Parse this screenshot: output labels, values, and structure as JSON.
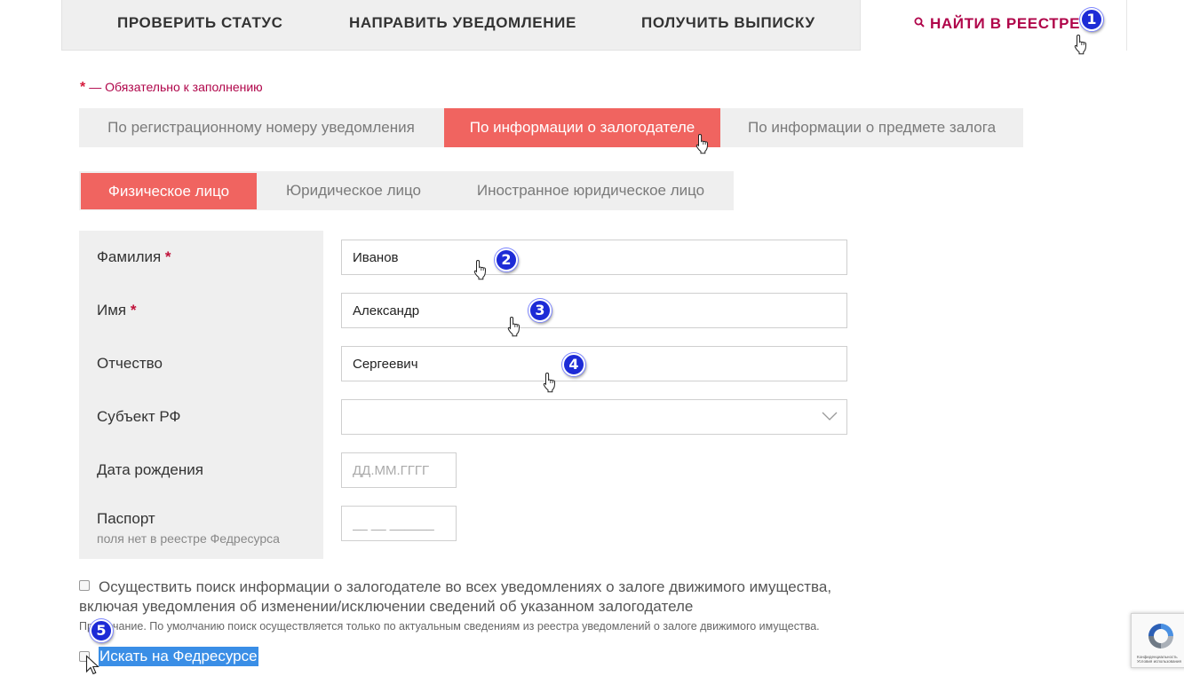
{
  "nav": {
    "items": [
      "ПРОВЕРИТЬ СТАТУС",
      "НАПРАВИТЬ УВЕДОМЛЕНИЕ",
      "ПОЛУЧИТЬ ВЫПИСКУ"
    ],
    "find_label": "НАЙТИ В РЕЕСТРЕ",
    "find_icon": "search-icon",
    "accent_color": "#b0054a"
  },
  "required_note": {
    "star": "*",
    "text": "— Обязательно к заполнению"
  },
  "mode_tabs": {
    "items": [
      "По регистрационному номеру уведомления",
      "По информации о залогодателе",
      "По информации о предмете залога"
    ],
    "active_index": 1,
    "active_color": "#f06460"
  },
  "person_tabs": {
    "items": [
      "Физическое лицо",
      "Юридическое лицо",
      "Иностранное юридическое лицо"
    ],
    "active_index": 0
  },
  "form": {
    "last_name": {
      "label": "Фамилия",
      "required_mark": "*",
      "value": "Иванов"
    },
    "first_name": {
      "label": "Имя",
      "required_mark": "*",
      "value": "Александр"
    },
    "patronymic": {
      "label": "Отчество",
      "value": "Сергеевич"
    },
    "region": {
      "label": "Субъект РФ",
      "value": ""
    },
    "birth_date": {
      "label": "Дата рождения",
      "placeholder": "ДД.ММ.ГГГГ"
    },
    "passport": {
      "label": "Паспорт",
      "sublabel": "поля нет в реестре Федресурса",
      "placeholder": "__ __ ______"
    }
  },
  "search_all": {
    "text": "Осуществить поиск информации о залогодателе во всех уведомлениях о залоге движимого имущества, включая уведомления об изменении/исключении сведений об указанном залогодателе",
    "checked": false
  },
  "note": "Примечание. По умолчанию поиск осуществляется только по актуальным сведениям из реестра уведомлений о залоге движимого имущества.",
  "fedresurs": {
    "label": "Искать на Федресурсе",
    "checked": false
  },
  "badges": [
    "1",
    "2",
    "3",
    "4",
    "5"
  ],
  "recaptcha": {
    "line1": "Конфиденциальность",
    "line2": "Условия использования"
  }
}
